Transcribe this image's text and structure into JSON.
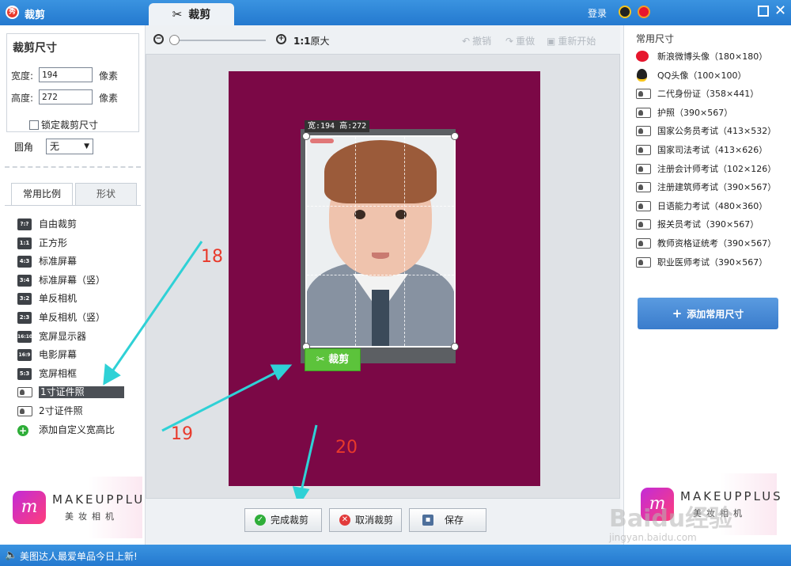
{
  "titlebar": {
    "app_title": "裁剪",
    "logo_char": "秀",
    "active_tab": "裁剪",
    "login": "登录",
    "icons": [
      "qq-icon",
      "weibo-icon",
      "maximize-icon",
      "close-icon"
    ]
  },
  "crop_size": {
    "title": "裁剪尺寸",
    "width_label": "宽度:",
    "width_value": "194",
    "height_label": "高度:",
    "height_value": "272",
    "unit": "像素",
    "lock_label": "锁定裁剪尺寸",
    "corner_label": "圆角",
    "corner_value": "无"
  },
  "left_tabs": [
    "常用比例",
    "形状"
  ],
  "ratios": [
    {
      "icon": "?:?",
      "label": "自由裁剪"
    },
    {
      "icon": "1:1",
      "label": "正方形"
    },
    {
      "icon": "4:3",
      "label": "标准屏幕"
    },
    {
      "icon": "3:4",
      "label": "标准屏幕（竖）"
    },
    {
      "icon": "3:2",
      "label": "单反相机"
    },
    {
      "icon": "2:3",
      "label": "单反相机（竖）"
    },
    {
      "icon": "16:10",
      "label": "宽屏显示器"
    },
    {
      "icon": "16:9",
      "label": "电影屏幕"
    },
    {
      "icon": "5:3",
      "label": "宽屏相框"
    },
    {
      "icon": "id-card-icon",
      "label": "1寸证件照",
      "selected": true
    },
    {
      "icon": "id-card-icon",
      "label": "2寸证件照"
    },
    {
      "icon": "add-icon",
      "label": "添加自定义宽高比"
    }
  ],
  "ad": {
    "brand": "MAKEUPPLUS",
    "sub": "美妆相机",
    "logo": "m"
  },
  "toolbar": {
    "zoom_ratio": "1:1",
    "zoom_original": "原大",
    "undo": "撤销",
    "redo": "重做",
    "restart": "重新开始"
  },
  "canvas": {
    "dim_label": "宽:194 高:272",
    "crop_button": "裁剪",
    "accent_bg": "#7b0846"
  },
  "annotations": [
    "18",
    "19",
    "20"
  ],
  "bottom_buttons": {
    "done": "完成裁剪",
    "cancel": "取消裁剪",
    "save": "保存"
  },
  "right_panel": {
    "title": "常用尺寸",
    "sizes": [
      {
        "icon": "weibo",
        "label": "新浪微博头像（180×180）"
      },
      {
        "icon": "qq",
        "label": "QQ头像（100×100）"
      },
      {
        "icon": "id",
        "label": "二代身份证（358×441）"
      },
      {
        "icon": "id",
        "label": "护照（390×567）"
      },
      {
        "icon": "id",
        "label": "国家公务员考试（413×532）"
      },
      {
        "icon": "id",
        "label": "国家司法考试（413×626）"
      },
      {
        "icon": "id",
        "label": "注册会计师考试（102×126）"
      },
      {
        "icon": "id",
        "label": "注册建筑师考试（390×567）"
      },
      {
        "icon": "id",
        "label": "日语能力考试（480×360）"
      },
      {
        "icon": "id",
        "label": "报关员考试（390×567）"
      },
      {
        "icon": "id",
        "label": "教师资格证统考（390×567）"
      },
      {
        "icon": "id",
        "label": "职业医师考试（390×567）"
      }
    ],
    "add_button": "添加常用尺寸"
  },
  "watermark": {
    "text": "Baidu经验",
    "url": "jingyan.baidu.com"
  },
  "statusbar": {
    "text": "美图达人最爱单品今日上新!"
  }
}
